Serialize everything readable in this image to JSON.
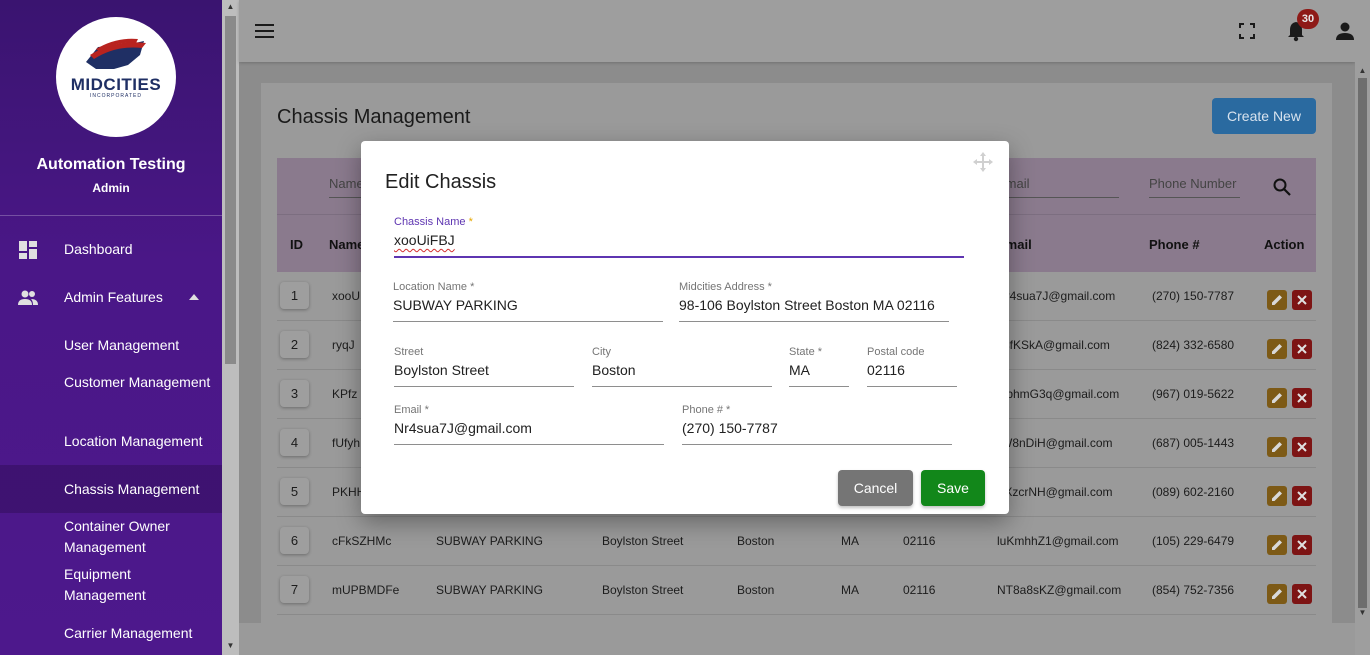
{
  "sidebar": {
    "logo_text": "MIDCITIES",
    "logo_subtext": "INCORPORATED",
    "user_name": "Automation Testing",
    "user_role": "Admin",
    "nav": [
      {
        "label": "Dashboard",
        "icon": "dashboard-icon"
      },
      {
        "label": "Admin Features",
        "icon": "people-icon"
      }
    ],
    "sub_items": [
      {
        "label": "User Management"
      },
      {
        "label": "Customer Management"
      },
      {
        "label": "Location Management"
      },
      {
        "label": "Chassis Management",
        "active": true
      },
      {
        "label": "Container Owner Management"
      },
      {
        "label": "Equipment Management"
      },
      {
        "label": "Carrier Management"
      }
    ]
  },
  "topbar": {
    "notification_count": "30",
    "icons": [
      "menu-icon",
      "fullscreen-icon",
      "bell-icon",
      "account-icon"
    ]
  },
  "page": {
    "title": "Chassis Management",
    "create_label": "Create New"
  },
  "table": {
    "filters": {
      "name": "Name",
      "email": "Email",
      "phone": "Phone Number"
    },
    "headers": {
      "id": "ID",
      "name": "Name",
      "email": "Email",
      "phone": "Phone #",
      "action": "Action"
    },
    "rows": [
      {
        "id": "1",
        "name": "xooU",
        "location": "",
        "street": "",
        "city": "",
        "state": "",
        "zip": "",
        "email": "Nr4sua7J@gmail.com",
        "phone": "(270) 150-7787"
      },
      {
        "id": "2",
        "name": "ryqJ",
        "location": "",
        "street": "",
        "city": "",
        "state": "",
        "zip": "",
        "email": "4sfKSkA@gmail.com",
        "phone": "(824) 332-6580"
      },
      {
        "id": "3",
        "name": "KPfz",
        "location": "",
        "street": "",
        "city": "",
        "state": "",
        "zip": "",
        "email": "GbhmG3q@gmail.com",
        "phone": "(967) 019-5622"
      },
      {
        "id": "4",
        "name": "fUfyh",
        "location": "",
        "street": "",
        "city": "",
        "state": "",
        "zip": "",
        "email": "rW8nDiH@gmail.com",
        "phone": "(687) 005-1443"
      },
      {
        "id": "5",
        "name": "PKHH",
        "location": "",
        "street": "",
        "city": "",
        "state": "",
        "zip": "",
        "email": "ZXzcrNH@gmail.com",
        "phone": "(089) 602-2160"
      },
      {
        "id": "6",
        "name": "cFkSZHMc",
        "location": "SUBWAY PARKING",
        "street": "Boylston Street",
        "city": "Boston",
        "state": "MA",
        "zip": "02116",
        "email": "luKmhhZ1@gmail.com",
        "phone": "(105) 229-6479"
      },
      {
        "id": "7",
        "name": "mUPBMDFe",
        "location": "SUBWAY PARKING",
        "street": "Boylston Street",
        "city": "Boston",
        "state": "MA",
        "zip": "02116",
        "email": "NT8a8sKZ@gmail.com",
        "phone": "(854) 752-7356"
      }
    ]
  },
  "modal": {
    "title": "Edit Chassis",
    "fields": {
      "chassis_name": {
        "label": "Chassis Name",
        "value": "xooUiFBJ"
      },
      "location_name": {
        "label": "Location Name",
        "value": "SUBWAY PARKING"
      },
      "address": {
        "label": "Midcities Address",
        "value": "98-106 Boylston Street Boston MA 02116"
      },
      "street": {
        "label": "Street",
        "value": "Boylston Street"
      },
      "city": {
        "label": "City",
        "value": "Boston"
      },
      "state": {
        "label": "State",
        "value": "MA"
      },
      "postal": {
        "label": "Postal code",
        "value": "02116"
      },
      "email": {
        "label": "Email",
        "value": "Nr4sua7J@gmail.com"
      },
      "phone": {
        "label": "Phone #",
        "value": "(270) 150-7787"
      }
    },
    "required_mark": "*",
    "cancel_label": "Cancel",
    "save_label": "Save"
  }
}
